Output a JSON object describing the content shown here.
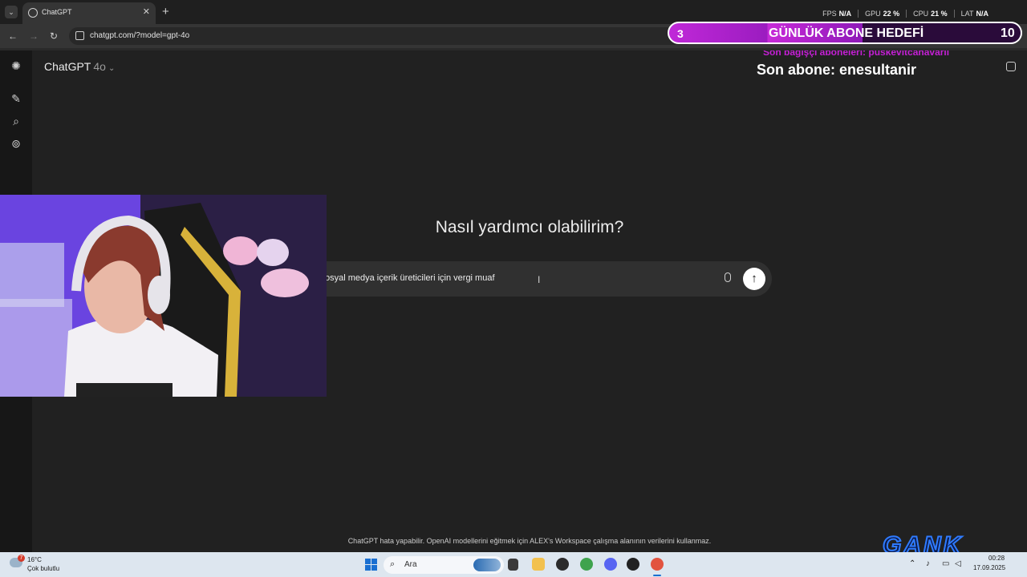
{
  "browser": {
    "tab_title": "ChatGPT",
    "url": "chatgpt.com/?model=gpt-4o"
  },
  "perf_overlay": [
    {
      "label": "FPS",
      "value": "N/A"
    },
    {
      "label": "GPU",
      "value": "22 %"
    },
    {
      "label": "CPU",
      "value": "21 %"
    },
    {
      "label": "LAT",
      "value": "N/A"
    }
  ],
  "stream_overlay": {
    "goal_current": "3",
    "goal_label": "GÜNLÜK ABONE HEDEFİ",
    "goal_target": "10",
    "goal_progress": 0.3,
    "last_donor_subscribers": "Son bağışçı aboneleri: puskevitcanavarii",
    "last_subscriber": "Son abone: enesultanir",
    "logo_text": "GANK"
  },
  "chatgpt": {
    "model_name": "ChatGPT",
    "model_version": "4o",
    "heading": "Nasıl yardımcı olabilirim?",
    "composer_text": "osyal medya içerik üreticileri için vergi muaf",
    "footer": "ChatGPT hata yapabilir. OpenAI modellerini eğitmek için ALEX's Workspace çalışma alanının verilerini kullanmaz."
  },
  "taskbar": {
    "weather_badge": "7",
    "weather_temp": "16°C",
    "weather_desc": "Çok bulutlu",
    "search_placeholder": "Ara",
    "time": "00:28",
    "date": "17.09.2025"
  },
  "colors": {
    "page_bg": "#212121",
    "rail_bg": "#171717",
    "composer_bg": "#303030",
    "goal_purple": "#c028d8",
    "donor_magenta": "#c51fd6",
    "taskbar_bg": "#dde6ef"
  },
  "icons": [
    "chevron-down-icon",
    "chatgpt-logo-icon",
    "new-chat-icon",
    "search-icon",
    "library-icon",
    "mic-icon",
    "send-arrow-icon",
    "windows-start-icon",
    "star-icon",
    "extensions-icon"
  ]
}
